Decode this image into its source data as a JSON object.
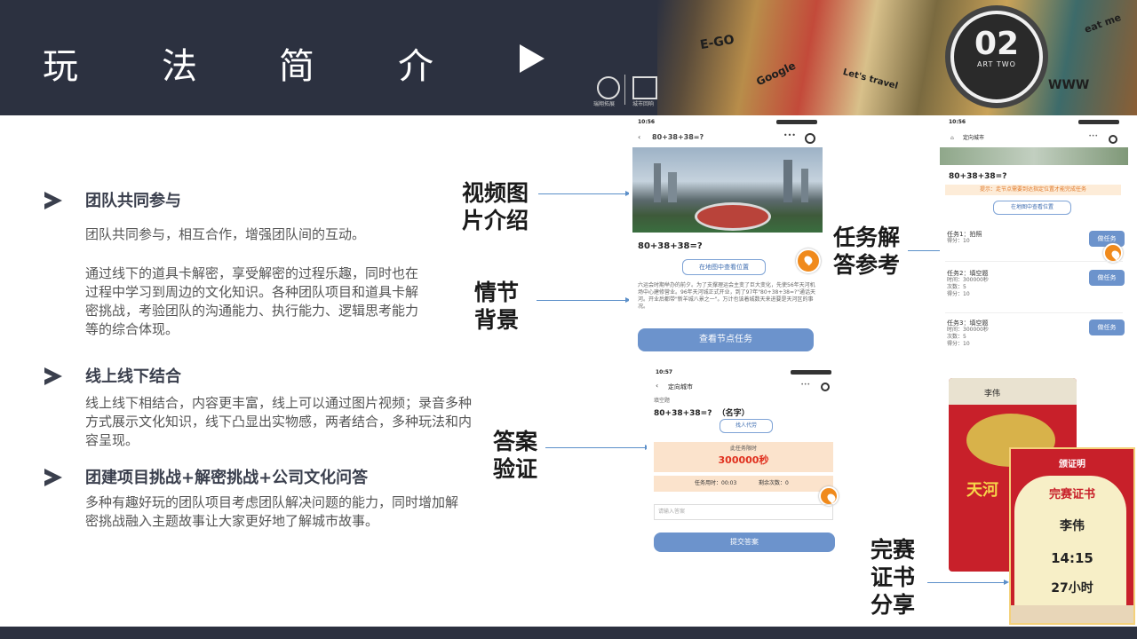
{
  "header": {
    "title_chars": [
      "玩",
      "法",
      "简",
      "介"
    ],
    "badge_number": "02",
    "badge_sub": "ART TWO",
    "logo_left_text": "瑞翔拓展",
    "logo_right_text": "城市回响",
    "doodle_words": [
      "E-GO",
      "Google",
      "Let's travel",
      "WWW",
      "eat me"
    ]
  },
  "sections": [
    {
      "title": "团队共同参与",
      "paragraphs": [
        "团队共同参与，相互合作，增强团队间的互动。",
        "通过线下的道具卡解密，享受解密的过程乐趣，同时也在过程中学习到周边的文化知识。各种团队项目和道具卡解密挑战，考验团队的沟通能力、执行能力、逻辑思考能力等的综合体现。"
      ]
    },
    {
      "title": "线上线下结合",
      "paragraphs": [
        "线上线下相结合，内容更丰富，线上可以通过图片视频；录音多种方式展示文化知识，线下凸显出实物感，两者结合，多种玩法和内容呈现。"
      ]
    },
    {
      "title": "团建项目挑战+解密挑战+公司文化问答",
      "paragraphs": [
        "多种有趣好玩的团队项目考虑团队解决问题的能力，同时增加解密挑战融入主题故事让大家更好地了解城市故事。"
      ]
    }
  ],
  "callouts": {
    "video": "视频图\n片介绍",
    "story": "情节\n背景",
    "answer_check": "答案\n验证",
    "task_ref": "任务解\n答参考",
    "certificate": "完赛\n证书\n分享"
  },
  "phone1": {
    "time": "10:56",
    "nav_title": "80+38+38=?",
    "question": "80+38+38=?",
    "map_btn": "在地图中查看位置",
    "story_text": "六运会时期举办的前夕。为了支撑理运会主变了巨大变化，先使56年天河机场中心建修营业。96年天河城正式开业，到了97年\"80+38+38=?\"通话天河。开业后都带\"新羊城八景之一\"。万计也该着城数天来进要是天河区的事况。",
    "task_btn": "查看节点任务"
  },
  "phone2": {
    "time": "10:56",
    "nav_title": "定向城市",
    "question": "80+38+38=?",
    "hint": "提示：走节点需要到达指定位置才能完成任务",
    "map_btn": "在地图中查看位置",
    "tasks": [
      {
        "name": "任务1：拍照",
        "score": "得分：10",
        "btn": "做任务"
      },
      {
        "name": "任务2：填空题",
        "time": "时间：300000秒",
        "count": "次数：5",
        "score": "得分：10",
        "btn": "做任务"
      },
      {
        "name": "任务3：填空题",
        "time": "时间：300000秒",
        "count": "次数：5",
        "score": "得分：10",
        "btn": "做任务"
      }
    ]
  },
  "phone3": {
    "time": "10:57",
    "nav_title": "定向城市",
    "label": "填空题",
    "question": "80+38+38=?  （名字）",
    "helper_btn": "找人代劳",
    "timer_label": "此任务限时",
    "timer_value": "300000秒",
    "used_time": "任务用时：00:03",
    "remaining": "剩余次数：0",
    "input_placeholder": "请输入答案",
    "submit_btn": "提交答案"
  },
  "certificate": {
    "name": "李伟",
    "title": "完赛证书",
    "subtitle": "颁证明",
    "time_value": "14:15",
    "duration": "27小时",
    "back_title": "天河",
    "back_name": "李伟"
  },
  "colors": {
    "header_bg": "#2c3140",
    "accent_blue": "#6c93cc",
    "orange": "#f08a1c",
    "cert_red": "#c8202a"
  }
}
